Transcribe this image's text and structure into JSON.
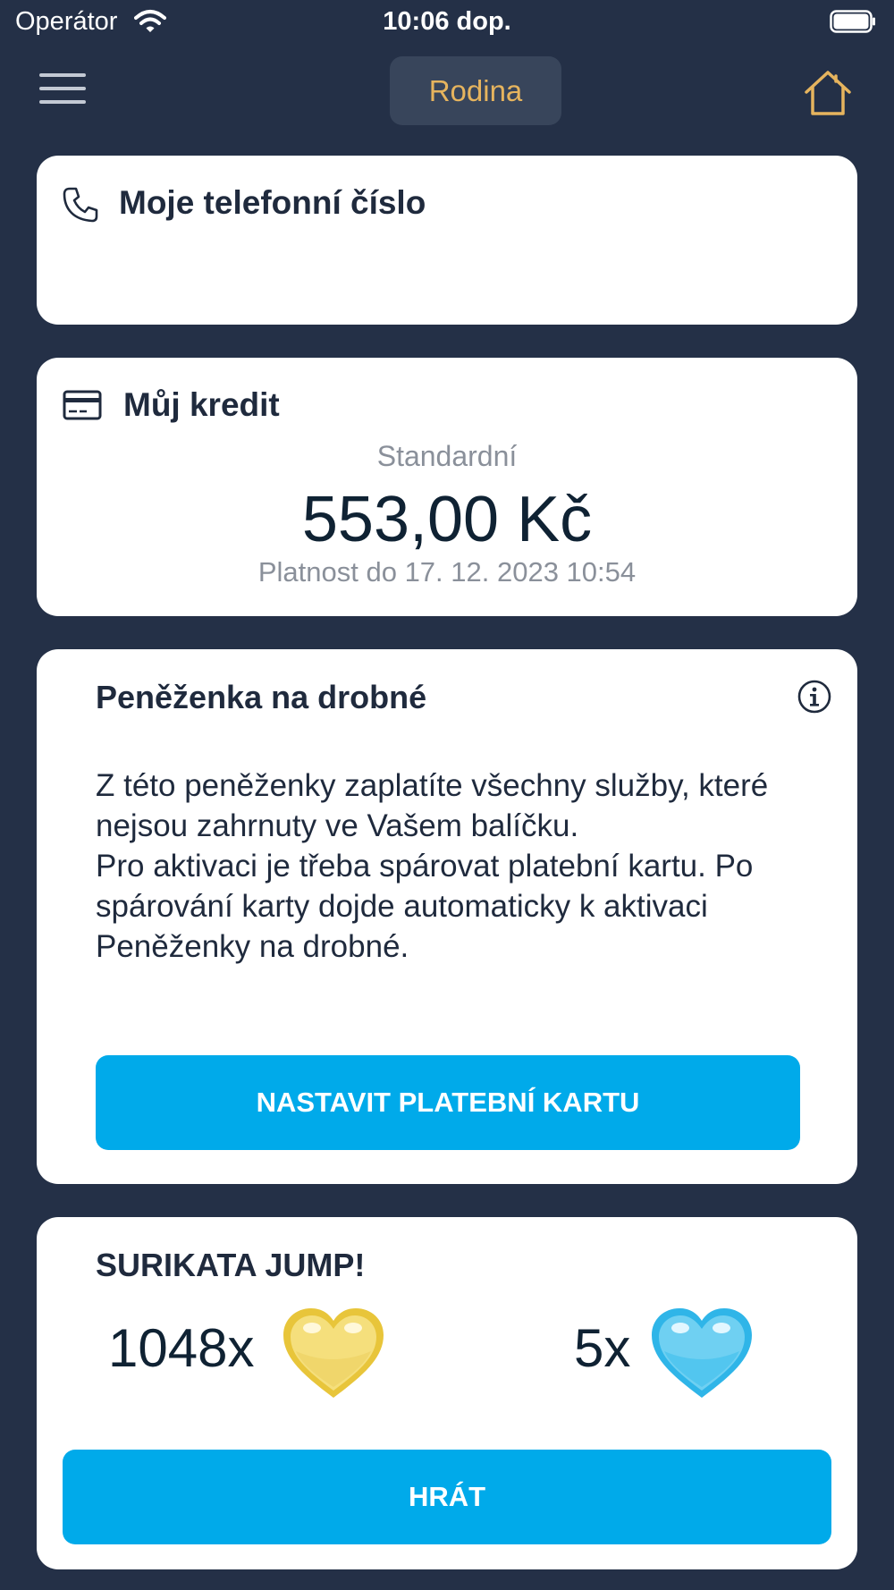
{
  "status_bar": {
    "carrier": "Operátor",
    "time": "10:06 dop.",
    "icons": [
      "wifi-icon",
      "battery-icon"
    ]
  },
  "nav": {
    "title": "Rodina",
    "icons": [
      "menu-icon",
      "home-icon"
    ],
    "accent_color": "#e6b45e"
  },
  "phone_card": {
    "title": "Moje telefonní číslo",
    "icon": "phone-icon"
  },
  "credit_card": {
    "title": "Můj kredit",
    "icon": "credit-card-icon",
    "tariff": "Standardní",
    "amount": "553,00 Kč",
    "valid_until": "Platnost do 17. 12. 2023 10:54"
  },
  "wallet_card": {
    "title": "Peněženka na drobné",
    "info_icon": "info-icon",
    "paragraph1": "Z této peněženky zaplatíte všechny služby, které nejsou zahrnuty ve Vašem balíčku.",
    "paragraph2": "Pro aktivaci je třeba spárovat platební kartu. Po spárování karty dojde automaticky k aktivaci Peněženky na drobné.",
    "button_label": "NASTAVIT PLATEBNÍ KARTU"
  },
  "game_card": {
    "title": "SURIKATA JUMP!",
    "gold_hearts": "1048x",
    "blue_hearts": "5x",
    "button_label": "HRÁT"
  },
  "colors": {
    "background": "#243047",
    "button": "#00aaea",
    "card": "#ffffff"
  }
}
